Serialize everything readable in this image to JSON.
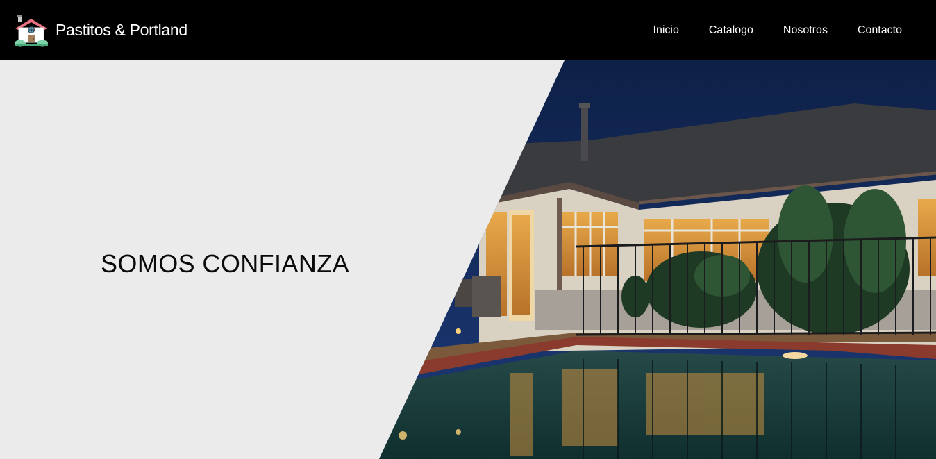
{
  "brand": {
    "name": "Pastitos & Portland",
    "logo_icon": "house-icon"
  },
  "nav": {
    "items": [
      {
        "label": "Inicio"
      },
      {
        "label": "Catalogo"
      },
      {
        "label": "Nosotros"
      },
      {
        "label": "Contacto"
      }
    ]
  },
  "hero": {
    "title": "SOMOS CONFIANZA",
    "image_subject": "house-with-pool-at-night"
  },
  "colors": {
    "navbar_bg": "#000000",
    "nav_text": "#ffffff",
    "hero_left_bg": "#ebebeb",
    "hero_title": "#0a0a0a"
  }
}
